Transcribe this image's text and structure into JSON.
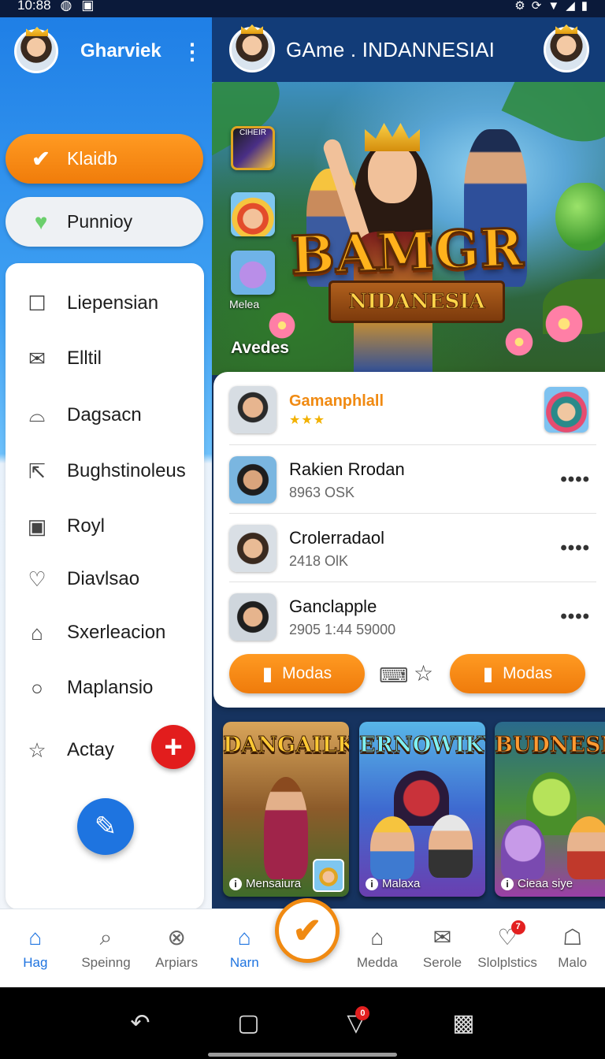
{
  "status_bar": {
    "time": "10:88"
  },
  "drawer": {
    "user_name": "Gharviek",
    "primary_button": "Klaidb",
    "secondary_button": "Punnioy",
    "menu": [
      {
        "label": "Liepensian",
        "icon": "edit-icon"
      },
      {
        "label": "Elltil",
        "icon": "mail-icon"
      },
      {
        "label": "Dagsacn",
        "icon": "basket-icon"
      },
      {
        "label": "Bughstinoleus",
        "icon": "share-icon"
      },
      {
        "label": "Royl",
        "icon": "id-card-icon"
      },
      {
        "label": "Diavlsao",
        "icon": "heart-icon"
      },
      {
        "label": "Sxerleacion",
        "icon": "star-house-icon"
      },
      {
        "label": "Maplansio",
        "icon": "circle-icon"
      },
      {
        "label": "Actay",
        "icon": "star-icon"
      }
    ],
    "bottom_nav": [
      {
        "label": "Hag",
        "icon": "home-icon"
      },
      {
        "label": "Speinng",
        "icon": "search-icon"
      },
      {
        "label": "Arpiars",
        "icon": "ball-icon"
      }
    ]
  },
  "main": {
    "app_title": "GAme . INDANNESIAI",
    "hero": {
      "title": "BAMGR",
      "subtitle": "NIDANESIA",
      "thumb_top_label": "CIHEIR",
      "thumb_caption": "Melea",
      "caption": "Avedes"
    },
    "players": [
      {
        "name": "Gamanphlall",
        "meta": "★★★"
      },
      {
        "name": "Rakien Rrodan",
        "meta": "8963 OSK"
      },
      {
        "name": "Crolerradaol",
        "meta": "2418 OlK"
      },
      {
        "name": "Ganclapple",
        "meta": "2905 1:44 59000"
      }
    ],
    "more_label": "••••",
    "action_buttons": {
      "left": "Modas",
      "right": "Modas"
    },
    "games": [
      {
        "title": "DANGAILK",
        "label": "Mensaiura"
      },
      {
        "title": "ERNOWIKY",
        "label": "Malaxa"
      },
      {
        "title": "BUDNESM",
        "label": "Cieaa siye"
      }
    ],
    "bottom_nav": [
      {
        "label": "Narn",
        "icon": "house-icon"
      },
      {
        "label": "Medda",
        "icon": "home-outline-icon"
      },
      {
        "label": "Serole",
        "icon": "mail-box-icon"
      },
      {
        "label": "Slolplstics",
        "icon": "heart-icon",
        "badge": "7"
      },
      {
        "label": "Malo",
        "icon": "profile-icon"
      }
    ]
  },
  "system_nav": {
    "notification_badge": "0"
  }
}
